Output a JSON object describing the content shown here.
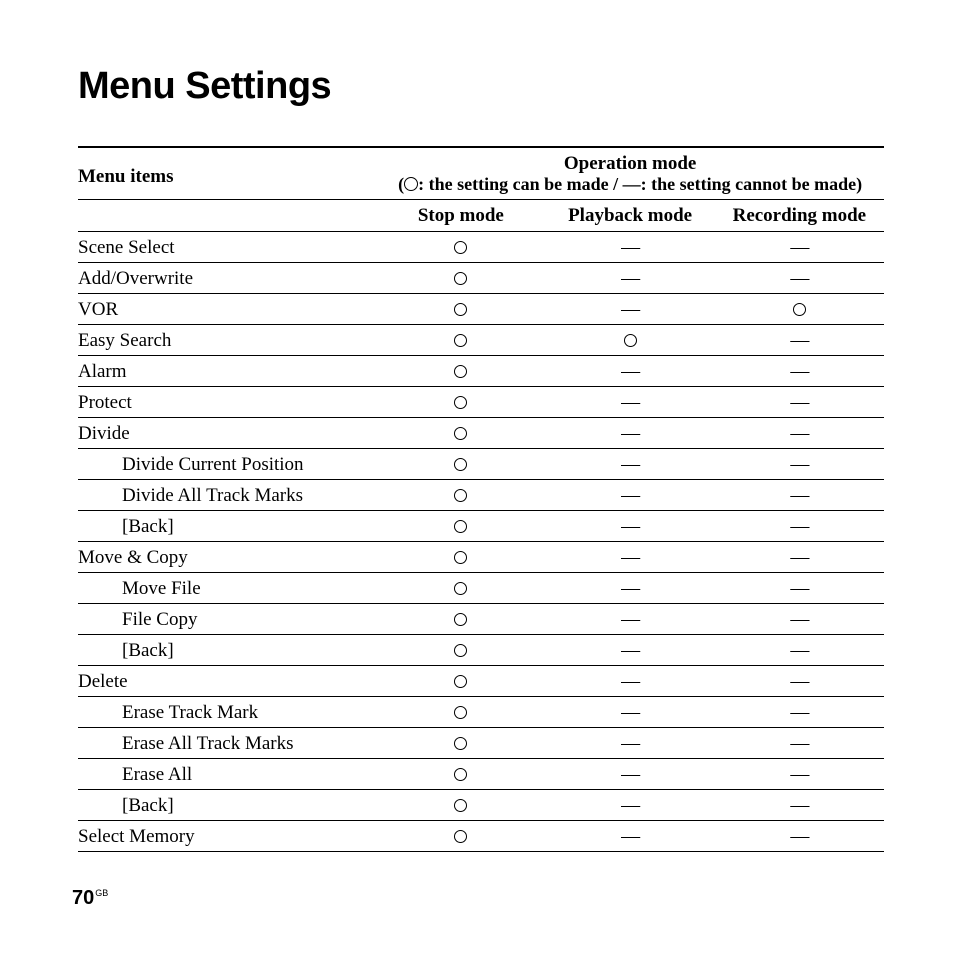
{
  "title": "Menu Settings",
  "table": {
    "header": {
      "menu_items": "Menu items",
      "operation_mode": "Operation mode",
      "legend_can": ": the setting can be made  / —: the setting cannot be made",
      "columns": {
        "stop": "Stop mode",
        "playback": "Playback mode",
        "recording": "Recording mode"
      }
    },
    "rows": [
      {
        "label": "Scene Select",
        "indent": false,
        "stop": "o",
        "playback": "-",
        "recording": "-"
      },
      {
        "label": "Add/Overwrite",
        "indent": false,
        "stop": "o",
        "playback": "-",
        "recording": "-"
      },
      {
        "label": "VOR",
        "indent": false,
        "stop": "o",
        "playback": "-",
        "recording": "o"
      },
      {
        "label": "Easy Search",
        "indent": false,
        "stop": "o",
        "playback": "o",
        "recording": "-"
      },
      {
        "label": "Alarm",
        "indent": false,
        "stop": "o",
        "playback": "-",
        "recording": "-"
      },
      {
        "label": "Protect",
        "indent": false,
        "stop": "o",
        "playback": "-",
        "recording": "-"
      },
      {
        "label": "Divide",
        "indent": false,
        "stop": "o",
        "playback": "-",
        "recording": "-"
      },
      {
        "label": "Divide Current Position",
        "indent": true,
        "stop": "o",
        "playback": "-",
        "recording": "-"
      },
      {
        "label": "Divide All Track Marks",
        "indent": true,
        "stop": "o",
        "playback": "-",
        "recording": "-"
      },
      {
        "label": "[Back]",
        "indent": true,
        "stop": "o",
        "playback": "-",
        "recording": "-"
      },
      {
        "label": "Move & Copy",
        "indent": false,
        "stop": "o",
        "playback": "-",
        "recording": "-"
      },
      {
        "label": "Move File",
        "indent": true,
        "stop": "o",
        "playback": "-",
        "recording": "-"
      },
      {
        "label": "File Copy",
        "indent": true,
        "stop": "o",
        "playback": "-",
        "recording": "-"
      },
      {
        "label": "[Back]",
        "indent": true,
        "stop": "o",
        "playback": "-",
        "recording": "-"
      },
      {
        "label": "Delete",
        "indent": false,
        "stop": "o",
        "playback": "-",
        "recording": "-"
      },
      {
        "label": "Erase Track Mark",
        "indent": true,
        "stop": "o",
        "playback": "-",
        "recording": "-"
      },
      {
        "label": "Erase All Track Marks",
        "indent": true,
        "stop": "o",
        "playback": "-",
        "recording": "-"
      },
      {
        "label": "Erase All",
        "indent": true,
        "stop": "o",
        "playback": "-",
        "recording": "-"
      },
      {
        "label": "[Back]",
        "indent": true,
        "stop": "o",
        "playback": "-",
        "recording": "-"
      },
      {
        "label": "Select Memory",
        "indent": false,
        "stop": "o",
        "playback": "-",
        "recording": "-"
      }
    ]
  },
  "footer": {
    "page_number": "70",
    "region": "GB"
  }
}
